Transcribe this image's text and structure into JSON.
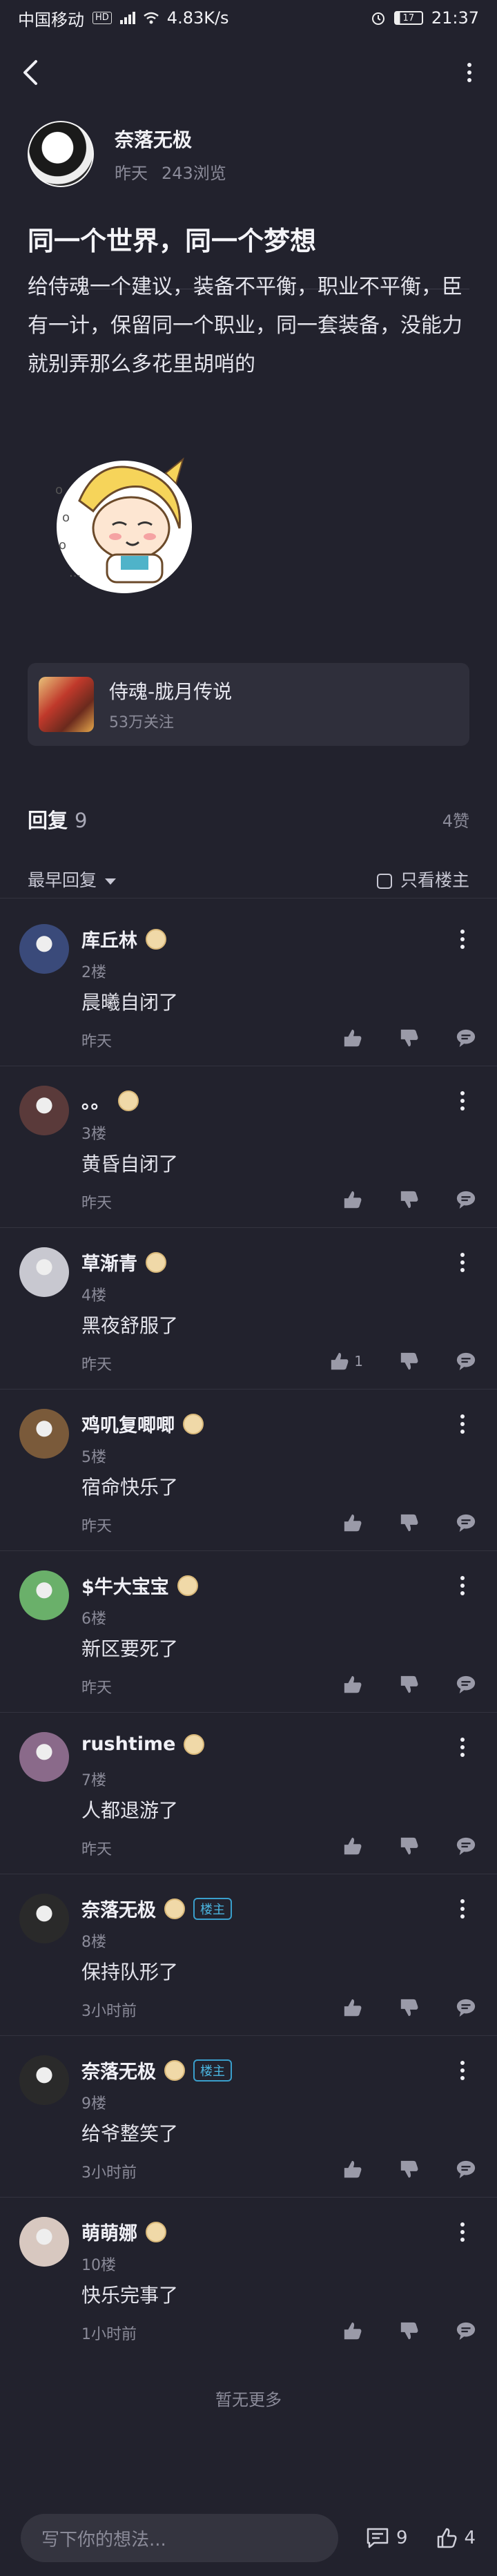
{
  "status_bar": {
    "carrier": "中国移动",
    "hd": "HD",
    "network_speed": "4.83K/s",
    "battery": "17",
    "time": "21:37"
  },
  "author": {
    "name": "奈落无极",
    "time": "昨天",
    "views": "243浏览"
  },
  "post": {
    "title": "同一个世界，同一个梦想",
    "body": "给侍魂一个建议，装备不平衡，职业不平衡，臣有一计，保留同一个职业，同一套装备，没能力就别弄那么多花里胡哨的"
  },
  "game": {
    "name": "侍魂-胧月传说",
    "followers": "53万关注"
  },
  "replies": {
    "label": "回复",
    "count": "9",
    "likes": "4赞",
    "sort_label": "最早回复",
    "only_owner_label": "只看楼主"
  },
  "comments": [
    {
      "name": "库丘林",
      "floor": "2楼",
      "text": "晨曦自闭了",
      "time": "昨天",
      "like_count": "",
      "owner_badge": "",
      "avatar_color": "#3a4a7a"
    },
    {
      "name": "。。",
      "floor": "3楼",
      "text": "黄昏自闭了",
      "time": "昨天",
      "like_count": "",
      "owner_badge": "",
      "avatar_color": "#5a3a3a"
    },
    {
      "name": "草渐青",
      "floor": "4楼",
      "text": "黑夜舒服了",
      "time": "昨天",
      "like_count": "1",
      "owner_badge": "",
      "avatar_color": "#c8c8d0"
    },
    {
      "name": "鸡叽复唧唧",
      "floor": "5楼",
      "text": "宿命快乐了",
      "time": "昨天",
      "like_count": "",
      "owner_badge": "",
      "avatar_color": "#7a5a3a"
    },
    {
      "name": "$牛大宝宝",
      "floor": "6楼",
      "text": "新区要死了",
      "time": "昨天",
      "like_count": "",
      "owner_badge": "",
      "avatar_color": "#6ab06a"
    },
    {
      "name": "rushtime",
      "floor": "7楼",
      "text": "人都退游了",
      "time": "昨天",
      "like_count": "",
      "owner_badge": "",
      "avatar_color": "#8a6a8a"
    },
    {
      "name": "奈落无极",
      "floor": "8楼",
      "text": "保持队形了",
      "time": "3小时前",
      "like_count": "",
      "owner_badge": "楼主",
      "avatar_color": "#2a2a2a"
    },
    {
      "name": "奈落无极",
      "floor": "9楼",
      "text": "给爷整笑了",
      "time": "3小时前",
      "like_count": "",
      "owner_badge": "楼主",
      "avatar_color": "#2a2a2a"
    },
    {
      "name": "萌萌娜",
      "floor": "10楼",
      "text": "快乐完事了",
      "time": "1小时前",
      "like_count": "",
      "owner_badge": "",
      "avatar_color": "#d8c8c0"
    }
  ],
  "no_more": "暂无更多",
  "bottom_bar": {
    "compose_placeholder": "写下你的想法...",
    "comment_count": "9",
    "like_count": "4"
  },
  "icons": [
    "back-icon",
    "more-icon",
    "level-badge-icon",
    "thumbs-up-icon",
    "thumbs-down-icon",
    "reply-icon",
    "comment-icon",
    "checkbox-icon"
  ]
}
